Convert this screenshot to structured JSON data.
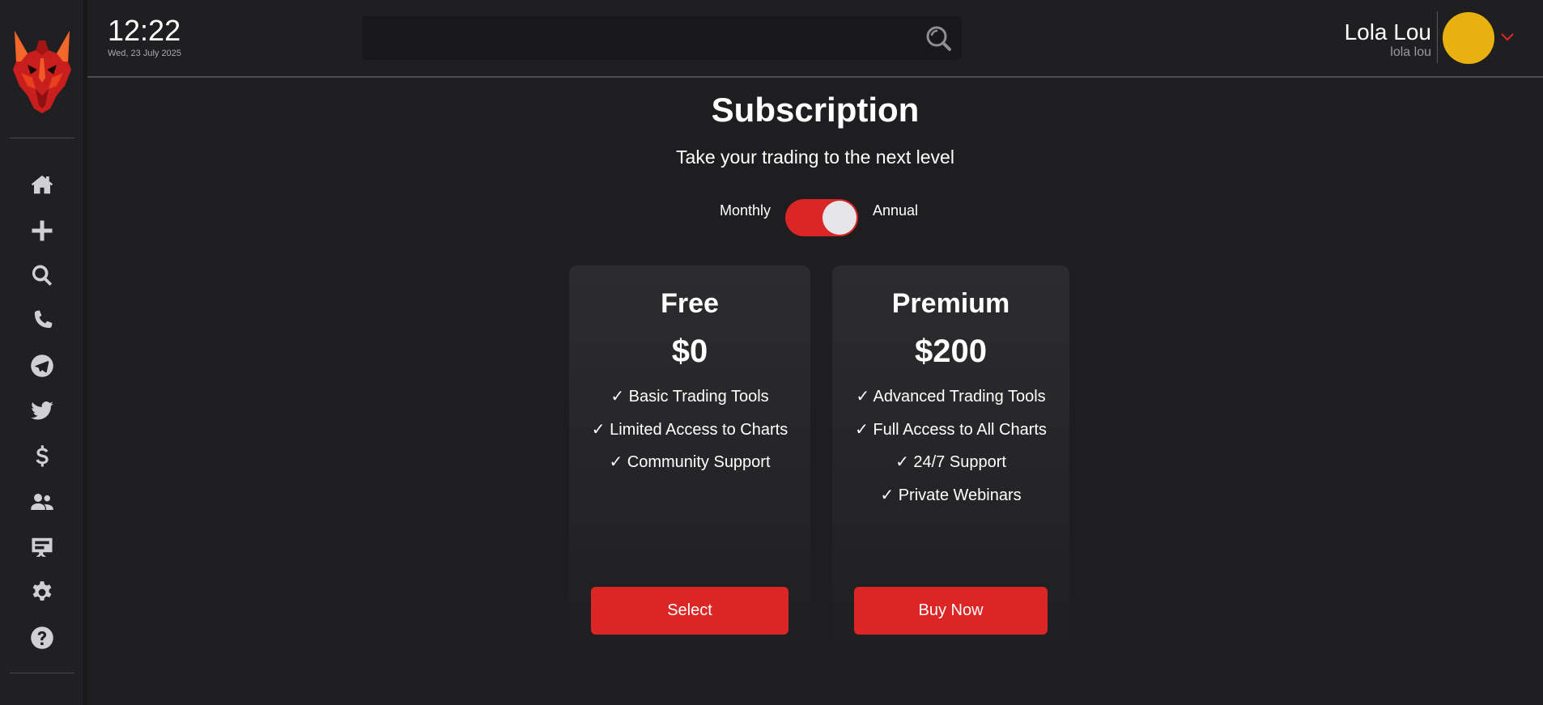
{
  "header": {
    "time": "12:22",
    "date": "Wed, 23 July 2025",
    "search": {
      "value": "",
      "placeholder": ""
    },
    "user": {
      "name": "Lola Lou",
      "handle": "lola lou"
    }
  },
  "sidebar": {
    "items": [
      {
        "name": "home",
        "icon": "home-icon"
      },
      {
        "name": "add",
        "icon": "plus-icon"
      },
      {
        "name": "search",
        "icon": "search-icon"
      },
      {
        "name": "phone",
        "icon": "phone-icon"
      },
      {
        "name": "telegram",
        "icon": "telegram-icon"
      },
      {
        "name": "twitter",
        "icon": "twitter-icon"
      },
      {
        "name": "pricing",
        "icon": "dollar-icon"
      },
      {
        "name": "users",
        "icon": "users-icon"
      },
      {
        "name": "presentation",
        "icon": "presentation-icon"
      },
      {
        "name": "settings",
        "icon": "gear-icon"
      },
      {
        "name": "help",
        "icon": "help-icon"
      }
    ]
  },
  "main": {
    "title": "Subscription",
    "subtitle": "Take your trading to the next level",
    "billing": {
      "left_label": "Monthly",
      "right_label": "Annual",
      "selected": "Annual"
    },
    "plans": [
      {
        "name": "Free",
        "price": "$0",
        "features": [
          "✓ Basic Trading Tools",
          "✓ Limited Access to Charts",
          "✓ Community Support"
        ],
        "button": "Select"
      },
      {
        "name": "Premium",
        "price": "$200",
        "features": [
          "✓ Advanced Trading Tools",
          "✓ Full Access to All Charts",
          "✓ 24/7 Support",
          "✓ Private Webinars"
        ],
        "button": "Buy Now"
      }
    ]
  },
  "colors": {
    "accent": "#dc2626",
    "avatar": "#e8b10f",
    "background": "#1e1e20",
    "card": "#2c2c2f"
  }
}
